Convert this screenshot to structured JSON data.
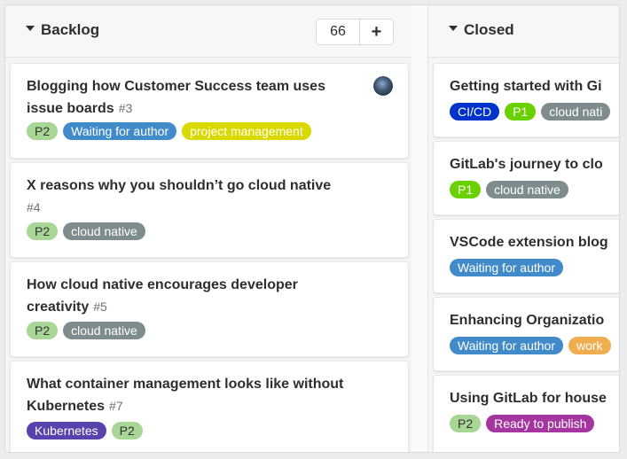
{
  "colors": {
    "p1": "#69d100",
    "p2": "#a8d695",
    "waiting_for_author": "#428bca",
    "project_management": "#d9d900",
    "cloud_native": "#7f8c8d",
    "kubernetes": "#5843ad",
    "ci_cd": "#0033cc",
    "ready_to_publish": "#a5359f",
    "orange": "#f0ad4e"
  },
  "backlog": {
    "title": "Backlog",
    "count": "66",
    "add_label": "+",
    "cards": [
      {
        "title": "Blogging how Customer Success team uses issue boards",
        "number": "#3",
        "labels": [
          "P2",
          "Waiting for author",
          "project management"
        ]
      },
      {
        "title": "X reasons why you shouldn’t go cloud native",
        "number": "#4",
        "labels": [
          "P2",
          "cloud native"
        ]
      },
      {
        "title": "How cloud native encourages developer creativity",
        "number": "#5",
        "labels": [
          "P2",
          "cloud native"
        ]
      },
      {
        "title": "What container management looks like without Kubernetes",
        "number": "#7",
        "labels": [
          "Kubernetes",
          "P2"
        ]
      }
    ]
  },
  "closed": {
    "title": "Closed",
    "cards": [
      {
        "title": "Getting started with Gi",
        "labels": [
          "CI/CD",
          "P1",
          "cloud nati"
        ]
      },
      {
        "title": "GitLab's journey to clo",
        "labels": [
          "P1",
          "cloud native"
        ]
      },
      {
        "title": "VSCode extension blog",
        "labels": [
          "Waiting for author"
        ]
      },
      {
        "title": "Enhancing Organizatio",
        "labels": [
          "Waiting for author",
          "work"
        ]
      },
      {
        "title": "Using GitLab for house",
        "labels": [
          "P2",
          "Ready to publish"
        ]
      }
    ]
  }
}
